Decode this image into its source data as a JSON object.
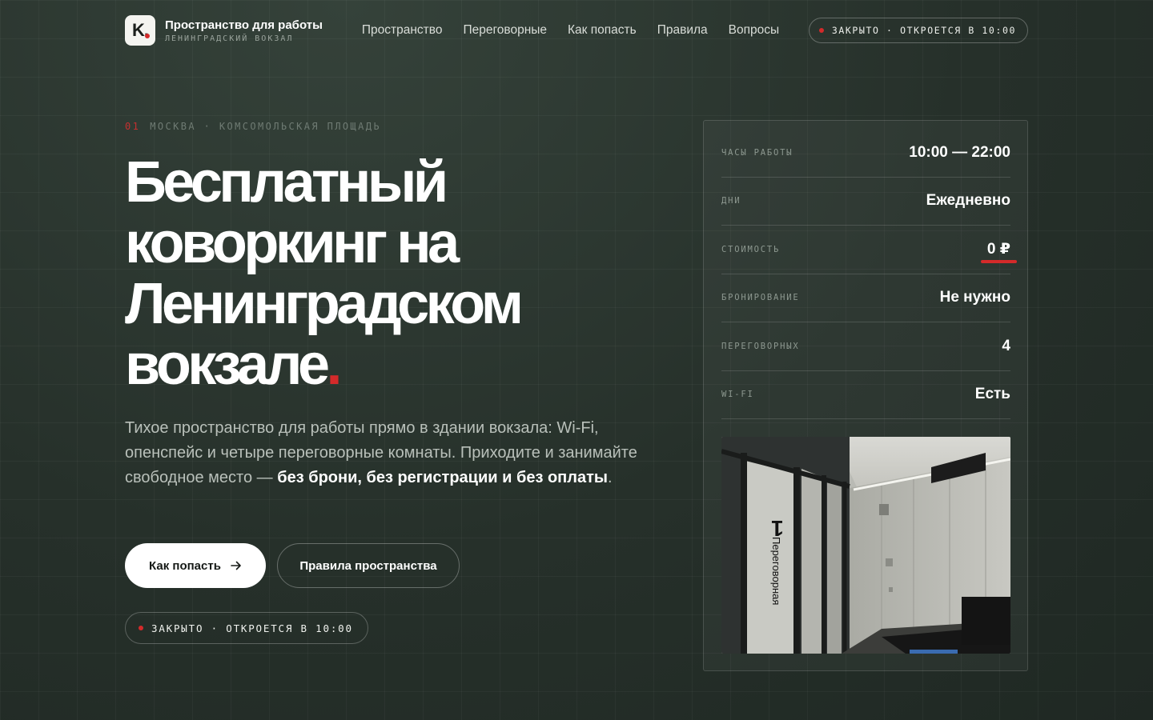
{
  "header": {
    "logo_letter": "K.",
    "brand_title": "Пространство для работы",
    "brand_subtitle": "ЛЕНИНГРАДСКИЙ ВОКЗАЛ",
    "nav": [
      "Пространство",
      "Переговорные",
      "Как попасть",
      "Правила",
      "Вопросы"
    ],
    "status": "ЗАКРЫТО · ОТКРОЕТСЯ В 10:00"
  },
  "hero": {
    "eyebrow_num": "01",
    "eyebrow_text": "МОСКВА · КОМСОМОЛЬСКАЯ ПЛОЩАДЬ",
    "title_lines": [
      "Бесплатный",
      "коворкинг на",
      "Ленинградском",
      "вокзале"
    ],
    "title_dot": ".",
    "desc_plain": "Тихое пространство для работы прямо в здании вокзала: Wi-Fi, опенспейс и четыре переговорные комнаты. Приходите и занимайте свободное место — ",
    "desc_bold": "без брони, без регистрации и без оплаты",
    "desc_end": ".",
    "primary_button": "Как попасть",
    "secondary_button": "Правила пространства",
    "status": "ЗАКРЫТО · ОТКРОЕТСЯ В 10:00"
  },
  "info": {
    "rows": [
      {
        "label": "ЧАСЫ РАБОТЫ",
        "value": "10:00 — 22:00"
      },
      {
        "label": "ДНИ",
        "value": "Ежедневно"
      },
      {
        "label": "СТОИМОСТЬ",
        "value": "0 ₽"
      },
      {
        "label": "БРОНИРОВАНИЕ",
        "value": "Не нужно"
      },
      {
        "label": "ПЕРЕГОВОРНЫХ",
        "value": "4"
      },
      {
        "label": "WI-FI",
        "value": "Есть"
      }
    ],
    "photo_sign": "Переговорная",
    "photo_sign_number": "1"
  },
  "colors": {
    "background": "#26302a",
    "accent": "#d42a2a",
    "text": "#ffffff"
  }
}
